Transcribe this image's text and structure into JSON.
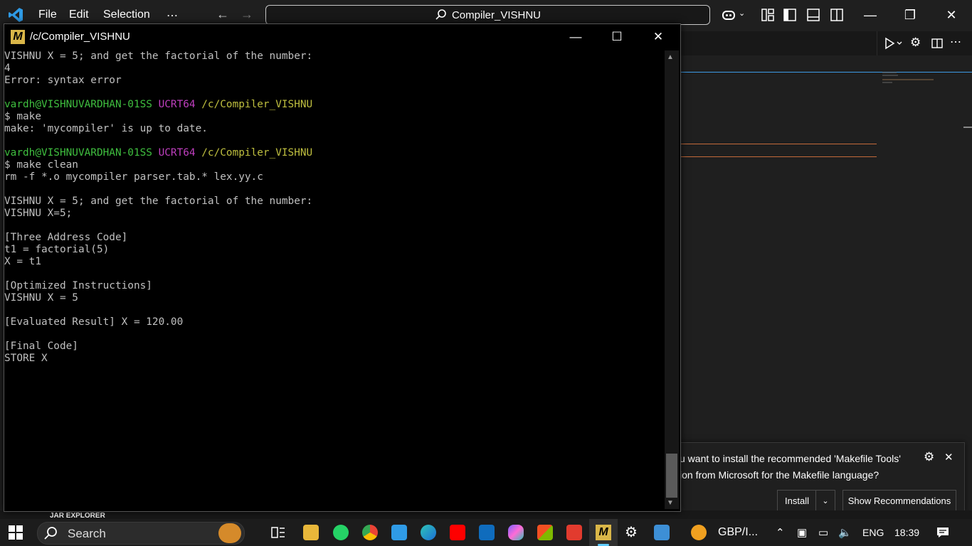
{
  "vscode": {
    "menu": [
      "File",
      "Edit",
      "Selection",
      "⋯"
    ],
    "command_center": "Compiler_VISHNU",
    "explorer_label": "JAR EXPLORER"
  },
  "terminal": {
    "title": "/c/Compiler_VISHNU",
    "lines": [
      {
        "segments": [
          {
            "text": "VISHNU X = 5; and get the factorial of the number:",
            "color": "#c0c0c0"
          }
        ]
      },
      {
        "segments": [
          {
            "text": "4",
            "color": "#c0c0c0"
          }
        ]
      },
      {
        "segments": [
          {
            "text": "Error: syntax error",
            "color": "#c0c0c0"
          }
        ]
      },
      {
        "segments": [
          {
            "text": "",
            "color": "#c0c0c0"
          }
        ]
      },
      {
        "segments": [
          {
            "text": "vardh@VISHNUVARDHAN-01SS",
            "color": "#3fbf3f"
          },
          {
            "text": " UCRT64",
            "color": "#bf3fbf"
          },
          {
            "text": " /c/Compiler_VISHNU",
            "color": "#bfbf3f"
          }
        ]
      },
      {
        "segments": [
          {
            "text": "$ make",
            "color": "#c0c0c0"
          }
        ]
      },
      {
        "segments": [
          {
            "text": "make: 'mycompiler' is up to date.",
            "color": "#c0c0c0"
          }
        ]
      },
      {
        "segments": [
          {
            "text": "",
            "color": "#c0c0c0"
          }
        ]
      },
      {
        "segments": [
          {
            "text": "vardh@VISHNUVARDHAN-01SS",
            "color": "#3fbf3f"
          },
          {
            "text": " UCRT64",
            "color": "#bf3fbf"
          },
          {
            "text": " /c/Compiler_VISHNU",
            "color": "#bfbf3f"
          }
        ]
      },
      {
        "segments": [
          {
            "text": "$ make clean",
            "color": "#c0c0c0"
          }
        ]
      },
      {
        "segments": [
          {
            "text": "rm -f *.o mycompiler parser.tab.* lex.yy.c",
            "color": "#c0c0c0"
          }
        ]
      },
      {
        "segments": [
          {
            "text": "",
            "color": "#c0c0c0"
          }
        ]
      },
      {
        "segments": [
          {
            "text": "VISHNU X = 5; and get the factorial of the number:",
            "color": "#c0c0c0"
          }
        ]
      },
      {
        "segments": [
          {
            "text": "VISHNU X=5;",
            "color": "#c0c0c0"
          }
        ]
      },
      {
        "segments": [
          {
            "text": "",
            "color": "#c0c0c0"
          }
        ]
      },
      {
        "segments": [
          {
            "text": "[Three Address Code]",
            "color": "#c0c0c0"
          }
        ]
      },
      {
        "segments": [
          {
            "text": "t1 = factorial(5)",
            "color": "#c0c0c0"
          }
        ]
      },
      {
        "segments": [
          {
            "text": "X = t1",
            "color": "#c0c0c0"
          }
        ]
      },
      {
        "segments": [
          {
            "text": "",
            "color": "#c0c0c0"
          }
        ]
      },
      {
        "segments": [
          {
            "text": "[Optimized Instructions]",
            "color": "#c0c0c0"
          }
        ]
      },
      {
        "segments": [
          {
            "text": "VISHNU X = 5",
            "color": "#c0c0c0"
          }
        ]
      },
      {
        "segments": [
          {
            "text": "",
            "color": "#c0c0c0"
          }
        ]
      },
      {
        "segments": [
          {
            "text": "[Evaluated Result] X = 120.00",
            "color": "#c0c0c0"
          }
        ]
      },
      {
        "segments": [
          {
            "text": "",
            "color": "#c0c0c0"
          }
        ]
      },
      {
        "segments": [
          {
            "text": "[Final Code]",
            "color": "#c0c0c0"
          }
        ]
      },
      {
        "segments": [
          {
            "text": "STORE X",
            "color": "#c0c0c0"
          }
        ]
      }
    ]
  },
  "notification": {
    "line1": "u want to install the recommended 'Makefile Tools'",
    "line2": "ion from Microsoft for the Makefile language?",
    "install_label": "Install",
    "recommendations_label": "Show Recommendations"
  },
  "taskbar": {
    "search_label": "Search",
    "ticker": "GBP/I...",
    "language": "ENG",
    "time": "18:39"
  },
  "icons": {
    "accent": "#3c9be6",
    "msys_logo": "#d9b648"
  }
}
